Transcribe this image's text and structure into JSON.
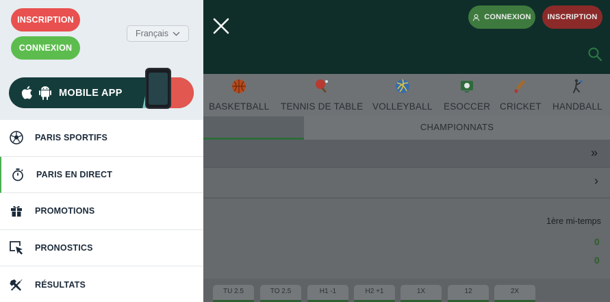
{
  "drawer": {
    "inscription": "INSCRIPTION",
    "connexion": "CONNEXION",
    "language": "Français",
    "mobile_app": "MOBILE APP",
    "menu": [
      {
        "label": "PARIS SPORTIFS",
        "icon": "soccer-ball-icon"
      },
      {
        "label": "PARIS EN DIRECT",
        "icon": "stopwatch-icon",
        "active": true
      },
      {
        "label": "PROMOTIONS",
        "icon": "gift-icon"
      },
      {
        "label": "PRONOSTICS",
        "icon": "cursor-select-icon"
      },
      {
        "label": "RÉSULTATS",
        "icon": "tools-icon"
      }
    ]
  },
  "header": {
    "connexion": "CONNEXION",
    "inscription": "INSCRIPTION"
  },
  "sports": [
    {
      "label": "BASKETBALL",
      "icon": "basketball-icon"
    },
    {
      "label": "TENNIS DE TABLE",
      "icon": "table-tennis-icon"
    },
    {
      "label": "VOLLEYBALL",
      "icon": "volleyball-icon"
    },
    {
      "label": "ESOCCER",
      "icon": "esoccer-icon"
    },
    {
      "label": "CRICKET",
      "icon": "cricket-icon"
    },
    {
      "label": "HANDBALL",
      "icon": "handball-icon"
    }
  ],
  "tabs": {
    "championnats": "CHAMPIONNATS"
  },
  "match": {
    "period": "1ère mi-temps",
    "score_home": "0",
    "score_away": "0"
  },
  "odds": [
    "TU 2.5",
    "TO 2.5",
    "H1 -1",
    "H2 +1",
    "1X",
    "12",
    "2X"
  ],
  "colors": {
    "inscription": "#e8514f",
    "connexion": "#5cbd4e",
    "header_bg": "#0f2e2a",
    "active_accent": "#4caf50"
  }
}
